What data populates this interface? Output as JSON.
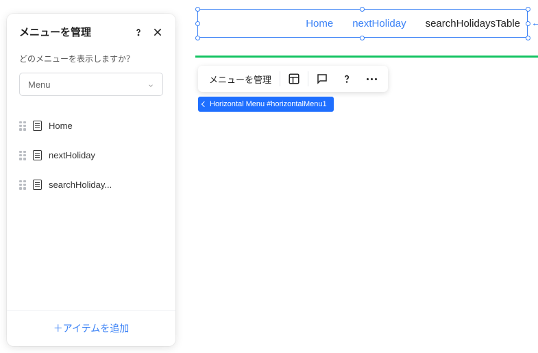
{
  "panel": {
    "title": "メニューを管理",
    "prompt": "どのメニューを表示しますか？",
    "select_value": "Menu",
    "items": [
      {
        "label": "Home"
      },
      {
        "label": "nextHoliday"
      },
      {
        "label": "searchHoliday..."
      }
    ],
    "add_label": "＋アイテムを追加"
  },
  "stage_menu": {
    "items": [
      {
        "label": "Home",
        "active": false
      },
      {
        "label": "nextHoliday",
        "active": false
      },
      {
        "label": "searchHolidaysTable",
        "active": true
      }
    ]
  },
  "toolbar": {
    "manage_label": "メニューを管理"
  },
  "badge": {
    "label": "Horizontal Menu #horizontalMenu1"
  }
}
